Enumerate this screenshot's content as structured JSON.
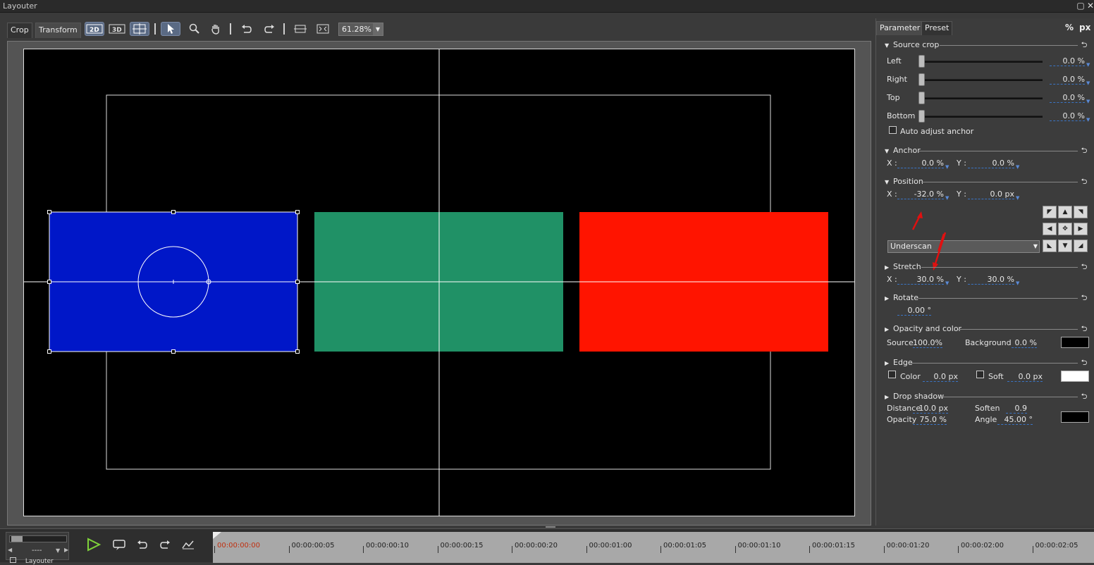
{
  "window": {
    "title": "Layouter"
  },
  "toolbar": {
    "tabs": [
      {
        "label": "Crop"
      },
      {
        "label": "Transform"
      }
    ],
    "zoom_value": "61.28%"
  },
  "panel": {
    "tabs": [
      {
        "label": "Parameter"
      },
      {
        "label": "Preset"
      }
    ],
    "units": [
      "%",
      "px"
    ],
    "source_crop": {
      "title": "Source crop",
      "rows": [
        {
          "label": "Left",
          "value": "0.0 %"
        },
        {
          "label": "Right",
          "value": "0.0 %"
        },
        {
          "label": "Top",
          "value": "0.0 %"
        },
        {
          "label": "Bottom",
          "value": "0.0 %"
        }
      ],
      "auto_adjust_label": "Auto adjust anchor"
    },
    "anchor": {
      "title": "Anchor",
      "x_label": "X :",
      "x_value": "0.0 %",
      "y_label": "Y :",
      "y_value": "0.0 %"
    },
    "position": {
      "title": "Position",
      "x_label": "X :",
      "x_value": "-32.0 %",
      "y_label": "Y :",
      "y_value": "0.0 px",
      "mode_value": "Underscan"
    },
    "stretch": {
      "title": "Stretch",
      "x_label": "X :",
      "x_value": "30.0 %",
      "y_label": "Y :",
      "y_value": "30.0 %"
    },
    "rotate": {
      "title": "Rotate",
      "value": "0.00 °"
    },
    "opacity_color": {
      "title": "Opacity and color",
      "source_label": "Source",
      "source_value": "100.0%",
      "background_label": "Background",
      "background_value": "0.0 %",
      "color": "#000000"
    },
    "edge": {
      "title": "Edge",
      "color_label": "Color",
      "color_value": "0.0 px",
      "soft_label": "Soft",
      "soft_value": "0.0 px",
      "color": "#ffffff"
    },
    "drop_shadow": {
      "title": "Drop shadow",
      "distance_label": "Distance",
      "distance_value": "10.0 px",
      "soften_label": "Soften",
      "soften_value": "0.9",
      "opacity_label": "Opacity",
      "opacity_value": "75.0 %",
      "angle_label": "Angle",
      "angle_value": "45.00 °",
      "color": "#000000"
    }
  },
  "canvas": {
    "colors": {
      "blue": "#0017c8",
      "green": "#209166",
      "red": "#ff1400"
    }
  },
  "timeline": {
    "small_field": "----",
    "bottom_label": "Layouter",
    "timecodes": [
      "00:00:00:00",
      "00:00:00:05",
      "00:00:00:10",
      "00:00:00:15",
      "00:00:00:20",
      "00:00:01:00",
      "00:00:01:05",
      "00:00:01:10",
      "00:00:01:15",
      "00:00:01:20",
      "00:00:02:00",
      "00:00:02:05"
    ]
  }
}
